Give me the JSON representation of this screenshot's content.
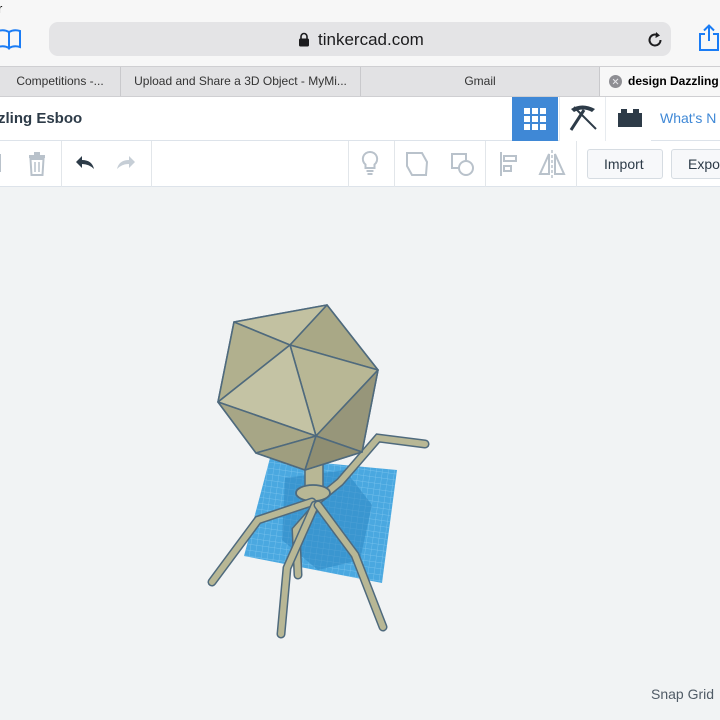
{
  "status_bar": {
    "fragment": "r"
  },
  "address_bar": {
    "url": "tinkercad.com"
  },
  "tabs": [
    {
      "label": "Competitions -..."
    },
    {
      "label": "Upload and Share a 3D Object - MyMi..."
    },
    {
      "label": "Gmail"
    },
    {
      "label": "design Dazzling Esboo"
    }
  ],
  "header": {
    "design_title": "zling Esboo",
    "whats_new": "What's N"
  },
  "toolbar": {
    "import_label": "Import",
    "export_label": "Expor"
  },
  "workspace": {
    "snap_grid_label": "Snap Grid"
  },
  "colors": {
    "accent": "#3f88d6",
    "shape_fill": "#b8b795",
    "shape_edge": "#4f6a7d",
    "workplane": "#4aa8e0"
  },
  "icons": [
    "book-icon",
    "lock-icon",
    "reload-icon",
    "share-icon",
    "tab-close-icon",
    "grid-view-icon",
    "pickaxe-icon",
    "brick-icon",
    "copy-icon",
    "trash-icon",
    "undo-icon",
    "redo-icon",
    "lightbulb-icon",
    "group-icon",
    "ungroup-icon",
    "align-icon",
    "mirror-icon"
  ]
}
